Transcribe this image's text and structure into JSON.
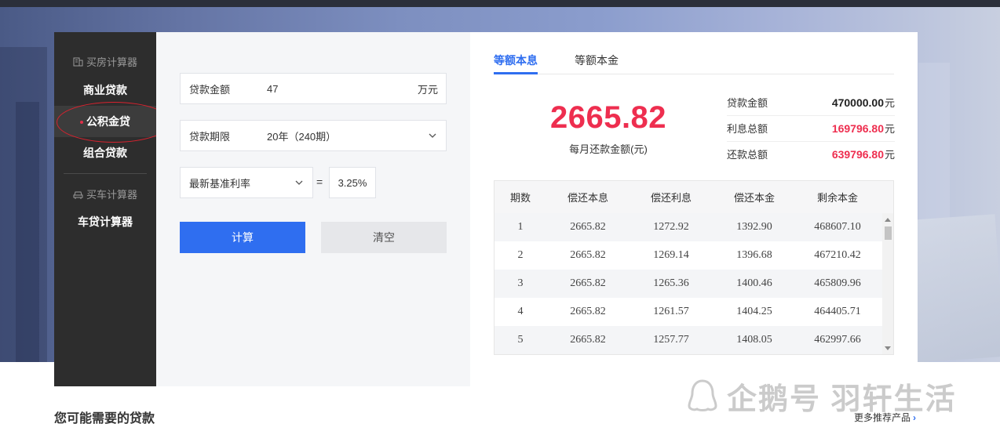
{
  "sidebar": {
    "house_category": "买房计算器",
    "items": [
      {
        "label": "商业贷款"
      },
      {
        "label": "公积金贷"
      },
      {
        "label": "组合贷款"
      }
    ],
    "car_category": "买车计算器",
    "car_items": [
      {
        "label": "车贷计算器"
      }
    ]
  },
  "form": {
    "amount_label": "贷款金额",
    "amount_value": "47",
    "amount_unit": "万元",
    "term_label": "贷款期限",
    "term_value": "20年（240期）",
    "rate_type": "最新基准利率",
    "equals": "=",
    "rate_value": "3.25%",
    "calc_button": "计算",
    "clear_button": "清空"
  },
  "results": {
    "tabs": [
      "等额本息",
      "等额本金"
    ],
    "monthly_payment": "2665.82",
    "monthly_label": "每月还款金额(元)",
    "summary": [
      {
        "label": "贷款金额",
        "value": "470000.00",
        "unit": "元",
        "color": "#222222"
      },
      {
        "label": "利息总额",
        "value": "169796.80",
        "unit": "元",
        "color": "#ee2e4f"
      },
      {
        "label": "还款总额",
        "value": "639796.80",
        "unit": "元",
        "color": "#ee2e4f"
      }
    ],
    "table": {
      "headers": [
        "期数",
        "偿还本息",
        "偿还利息",
        "偿还本金",
        "剩余本金"
      ],
      "rows": [
        [
          "1",
          "2665.82",
          "1272.92",
          "1392.90",
          "468607.10"
        ],
        [
          "2",
          "2665.82",
          "1269.14",
          "1396.68",
          "467210.42"
        ],
        [
          "3",
          "2665.82",
          "1265.36",
          "1400.46",
          "465809.96"
        ],
        [
          "4",
          "2665.82",
          "1261.57",
          "1404.25",
          "464405.71"
        ],
        [
          "5",
          "2665.82",
          "1257.77",
          "1408.05",
          "462997.66"
        ]
      ]
    }
  },
  "bottom": {
    "title": "您可能需要的贷款",
    "more_link": "更多推荐产品",
    "more_arrow": "›"
  },
  "watermark": "企鹅号 羽轩生活",
  "colors": {
    "accent_blue": "#2f6ef0",
    "accent_red": "#ee2e4f",
    "sidebar_bg": "#2d2d2d"
  }
}
